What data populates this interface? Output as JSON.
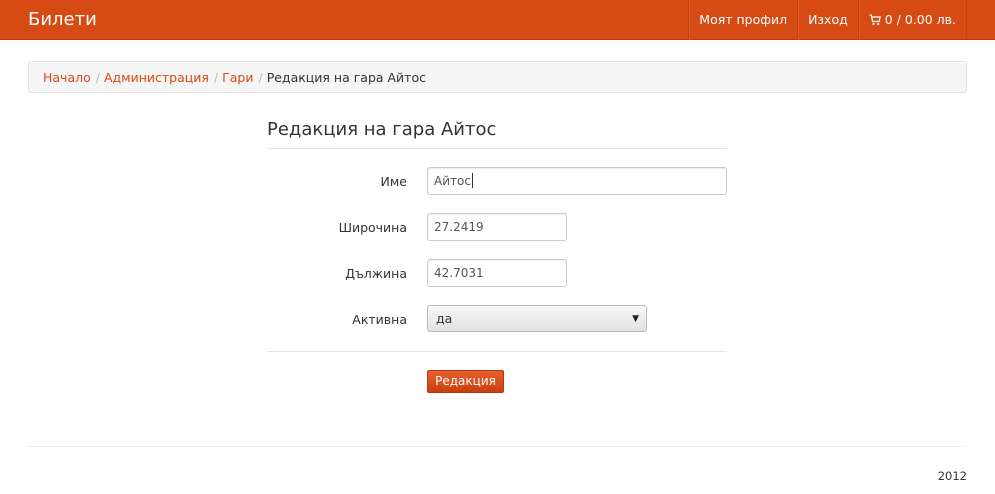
{
  "navbar": {
    "brand": "Билети",
    "items": [
      {
        "label": "Моят профил"
      },
      {
        "label": "Изход"
      }
    ],
    "cart": {
      "label": "0 / 0.00 лв.",
      "icon": "shopping-cart-icon"
    },
    "colors": {
      "background": "#d64a13",
      "text": "#ffffff"
    }
  },
  "breadcrumb": {
    "items": [
      {
        "label": "Начало"
      },
      {
        "label": "Администрация"
      },
      {
        "label": "Гари"
      }
    ],
    "separator": "/",
    "active": "Редакция на гара Айтос"
  },
  "form": {
    "title": "Редакция на гара Айтос",
    "fields": {
      "name": {
        "label": "Име",
        "value": "Айтос"
      },
      "latitude": {
        "label": "Широчина",
        "value": "27.2419"
      },
      "longitude": {
        "label": "Дължина",
        "value": "42.7031"
      },
      "active": {
        "label": "Активна",
        "value": "да"
      }
    },
    "submit_label": "Редакция"
  },
  "footer": {
    "text": "2012"
  },
  "colors": {
    "accent": "#d64a13",
    "link": "#d64a13"
  }
}
